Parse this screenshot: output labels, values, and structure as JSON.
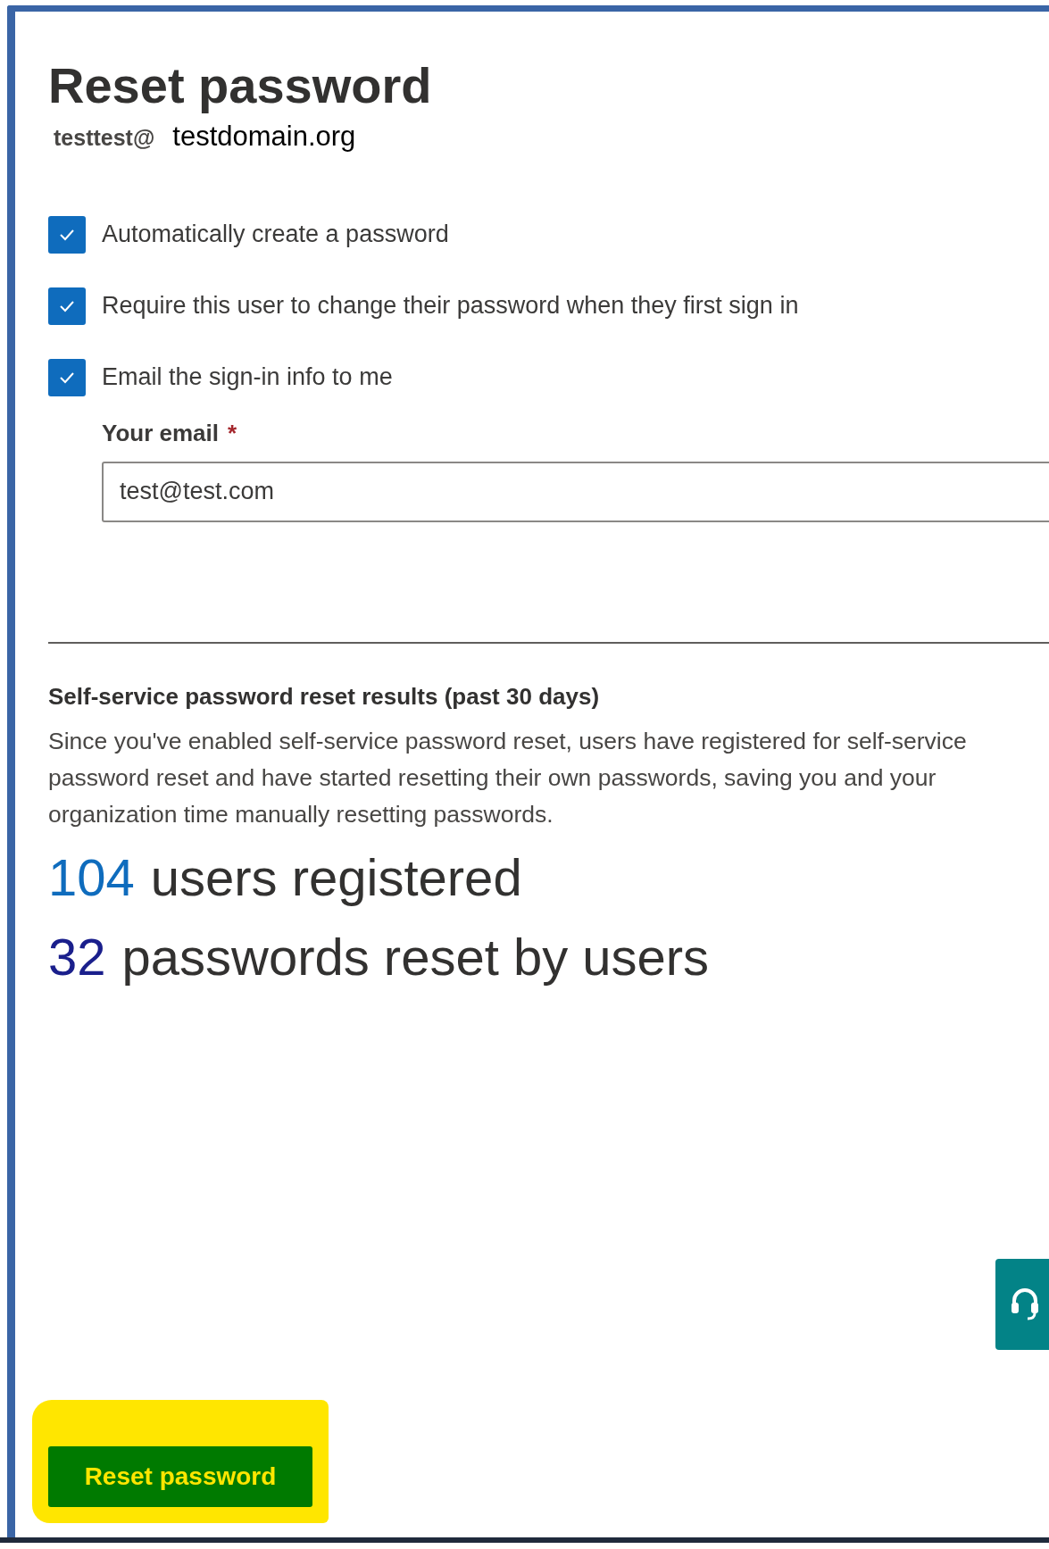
{
  "title": "Reset password",
  "account": {
    "user": "testtest@",
    "domain": "testdomain.org"
  },
  "options": [
    {
      "label": "Automatically create a password",
      "checked": true
    },
    {
      "label": "Require this user to change their password when they first sign in",
      "checked": true
    },
    {
      "label": "Email the sign-in info to me",
      "checked": true
    }
  ],
  "email_field": {
    "label": "Your email",
    "required_mark": "*",
    "value": "test@test.com"
  },
  "results": {
    "heading": "Self-service password reset results (past 30 days)",
    "description": "Since you've enabled self-service password reset, users have registered for self-service password reset and have started resetting their own passwords, saving you and your organization time manually resetting passwords.",
    "stats": [
      {
        "number": "104",
        "label": "users registered",
        "color": "#0f6cbd"
      },
      {
        "number": "32",
        "label": "passwords reset by users",
        "color": "#1a1f8c"
      }
    ]
  },
  "primary_button": {
    "label": "Reset password",
    "highlighted": true
  }
}
